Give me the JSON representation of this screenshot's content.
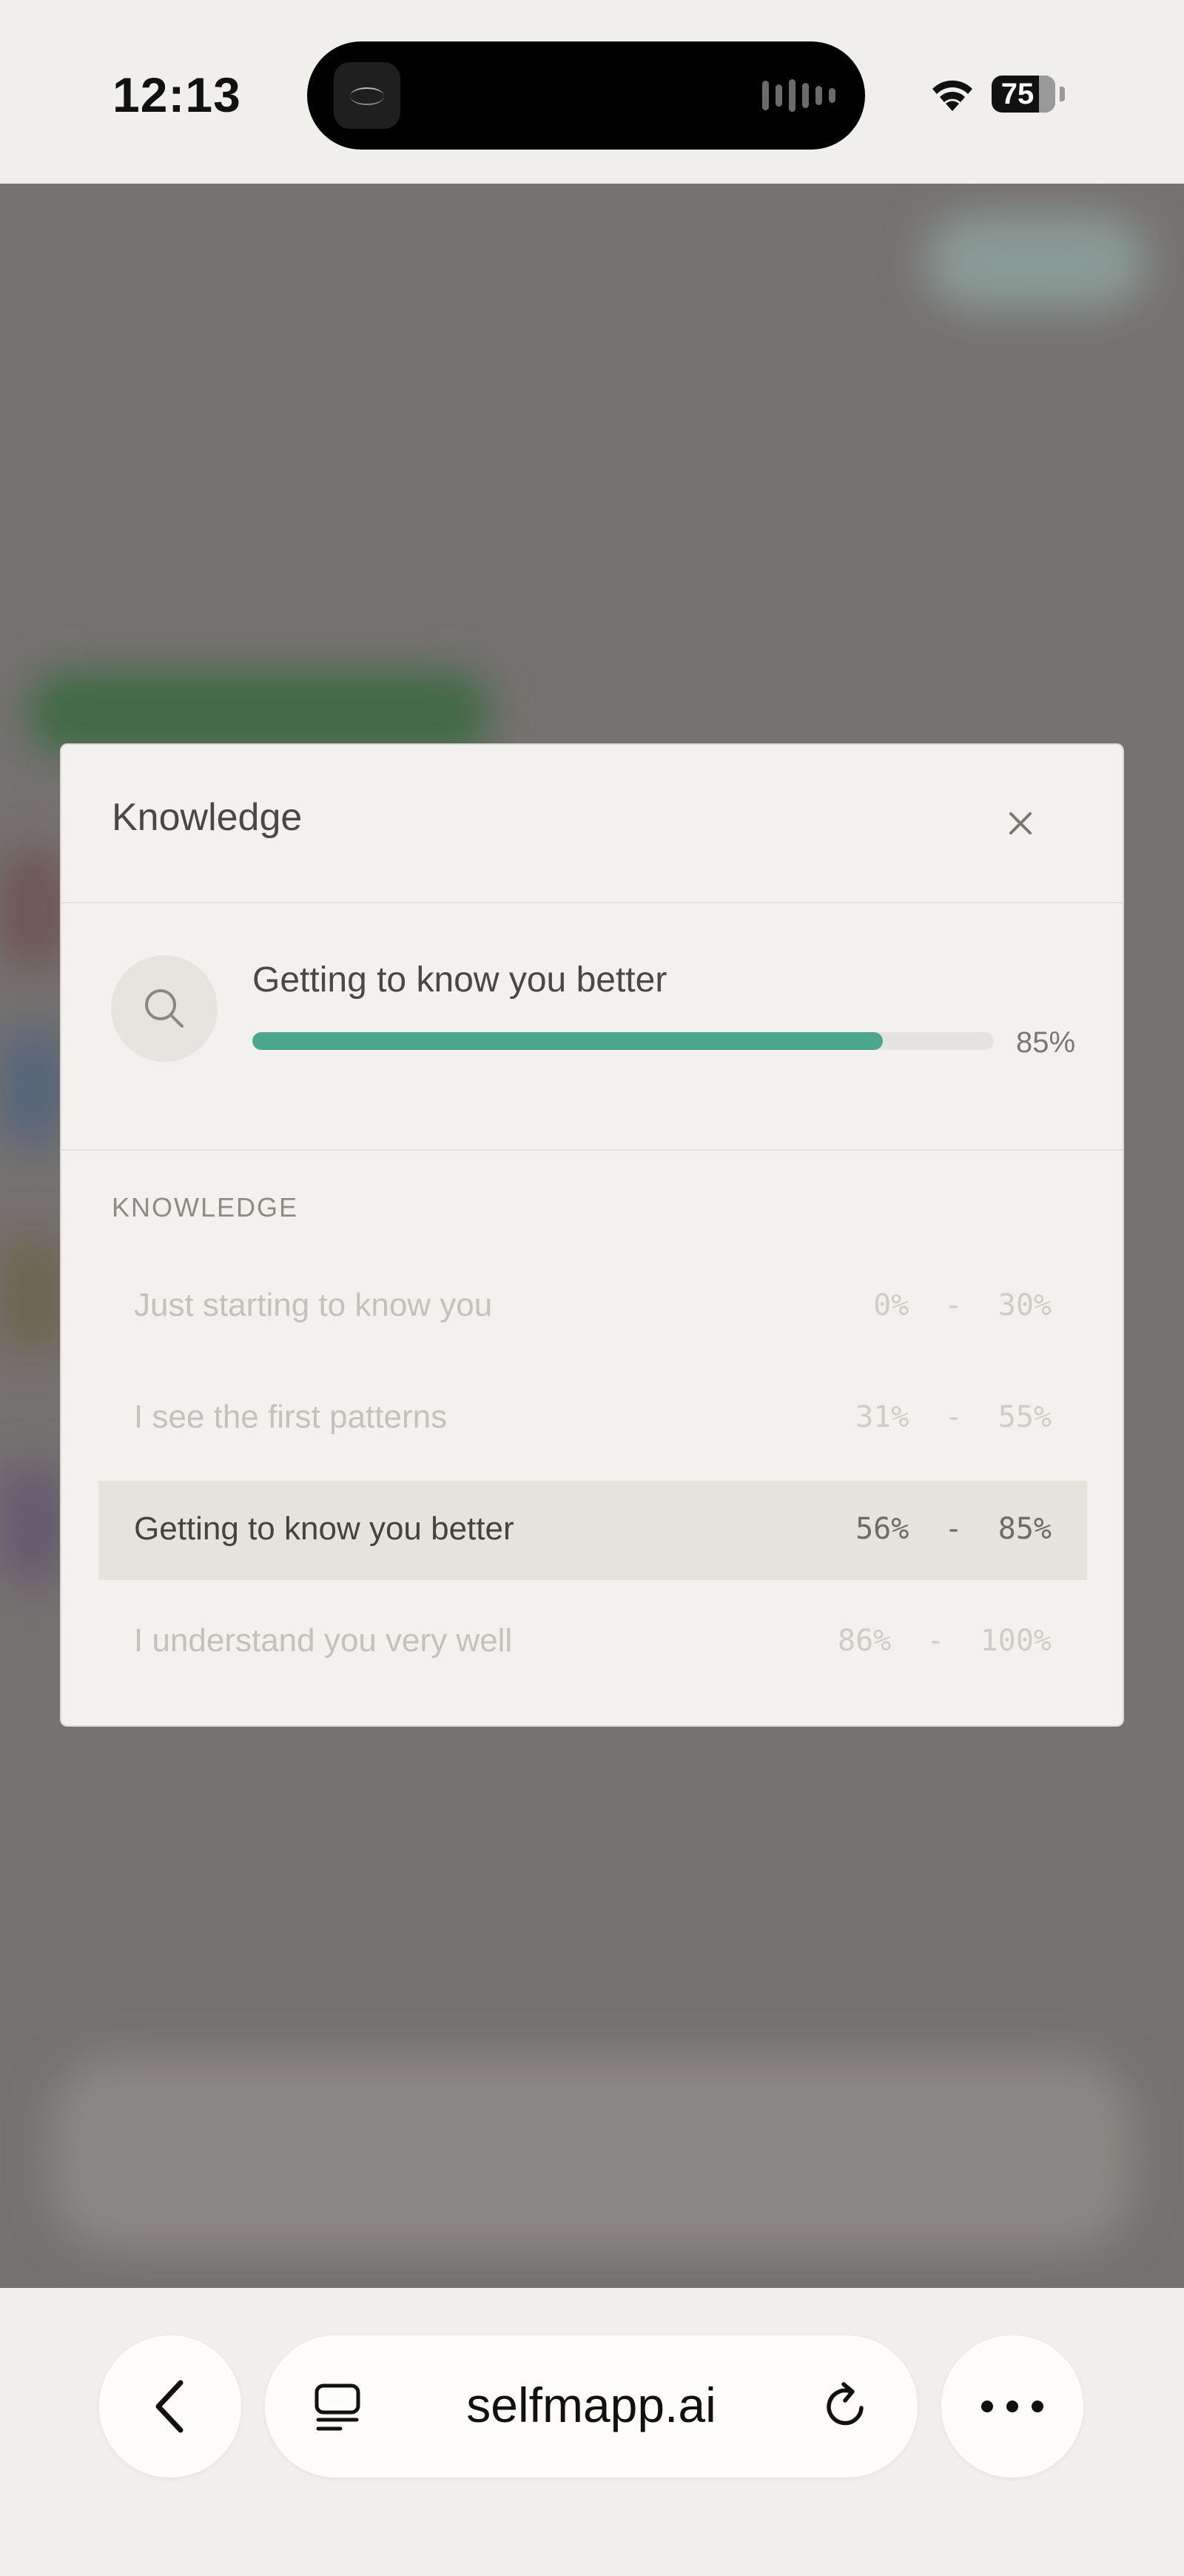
{
  "status_bar": {
    "time": "12:13",
    "battery": "75",
    "icons": [
      "app-icon",
      "audio-wave-icon",
      "wifi-icon",
      "battery-icon"
    ]
  },
  "modal": {
    "title": "Knowledge",
    "current_level": {
      "label": "Getting to know you better",
      "progress_percent": 85,
      "progress_label": "85%"
    },
    "section_label": "KNOWLEDGE",
    "levels": [
      {
        "label": "Just starting to know you",
        "range": "0%  -  30%",
        "active": false
      },
      {
        "label": "I see the first patterns",
        "range": "31%  -  55%",
        "active": false
      },
      {
        "label": "Getting to know you better",
        "range": "56%  -  85%",
        "active": true
      },
      {
        "label": "I understand you very well",
        "range": "86%  -  100%",
        "active": false
      }
    ],
    "colors": {
      "progress_fill": "#4ca68e",
      "active_row": "#e6e3dd",
      "surface": "#f3f1ed"
    }
  },
  "browser": {
    "url": "selfmapp.ai",
    "icons": [
      "back-chevron-icon",
      "tabs-icon",
      "reload-icon",
      "more-dots-icon"
    ]
  }
}
